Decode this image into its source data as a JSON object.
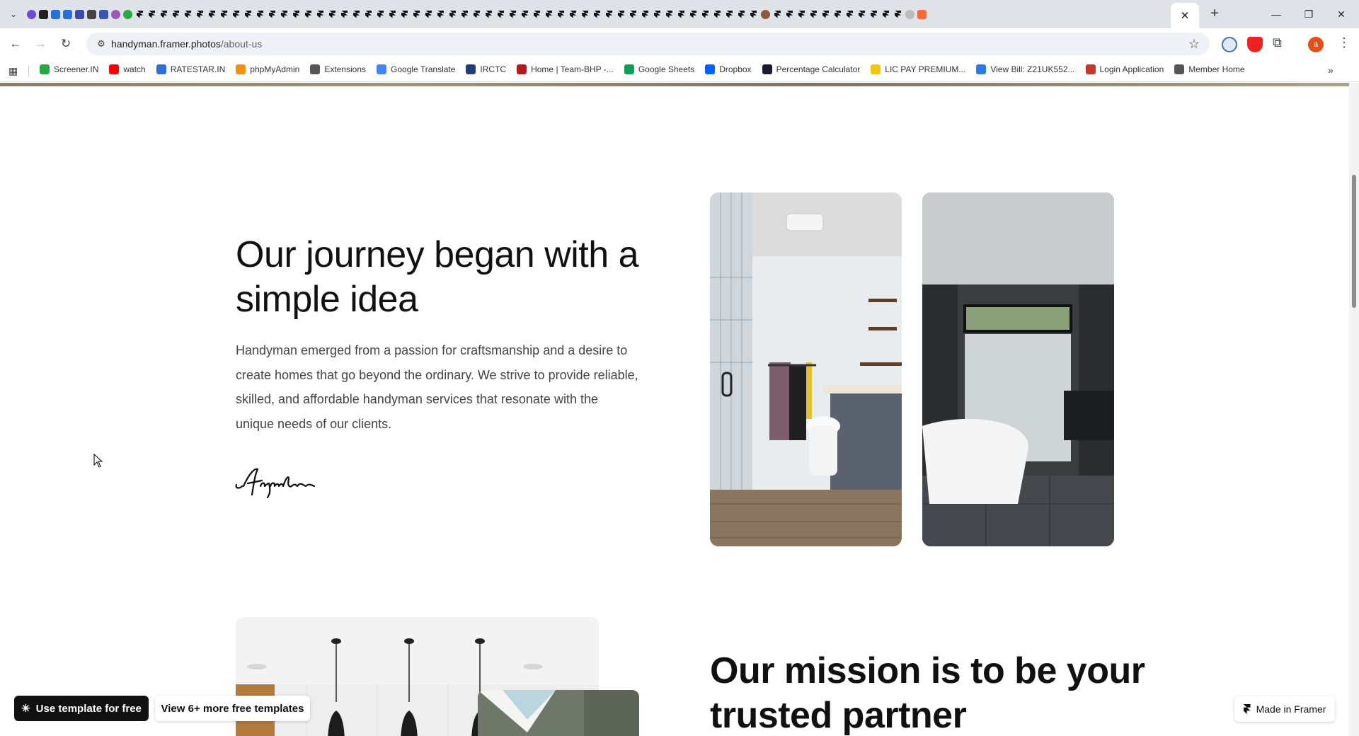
{
  "browser": {
    "url_host": "handyman.framer.photos",
    "url_path": "/about-us",
    "window_controls": {
      "minimize": "—",
      "restore": "❐",
      "close": "✕"
    },
    "new_tab_label": "+",
    "profile_initial": "a",
    "active_tab_close": "✕"
  },
  "bookmarks": [
    {
      "label": "Screener.IN",
      "color": "#27a844"
    },
    {
      "label": "watch",
      "color": "#ff0000"
    },
    {
      "label": "RATESTAR.IN",
      "color": "#2e6fd8"
    },
    {
      "label": "phpMyAdmin",
      "color": "#f29111"
    },
    {
      "label": "Extensions",
      "color": "#555555"
    },
    {
      "label": "Google Translate",
      "color": "#4285f4"
    },
    {
      "label": "IRCTC",
      "color": "#213d77"
    },
    {
      "label": "Home | Team-BHP -...",
      "color": "#b31b1b"
    },
    {
      "label": "Google Sheets",
      "color": "#0f9d58"
    },
    {
      "label": "Dropbox",
      "color": "#0061fe"
    },
    {
      "label": "Percentage Calculator",
      "color": "#1a1a2e"
    },
    {
      "label": "LIC PAY PREMIUM...",
      "color": "#f3c40d"
    },
    {
      "label": "View Bill: Z21UK552...",
      "color": "#2c7be5"
    },
    {
      "label": "Login Application",
      "color": "#c0392b"
    },
    {
      "label": "Member Home",
      "color": "#555555"
    }
  ],
  "content": {
    "heading": "Our journey began with a simple idea",
    "paragraph": "Handyman emerged from a passion for craftsmanship and a desire to create homes that go beyond the ordinary. We strive to provide reliable, skilled, and affordable handyman services that resonate with the unique needs of our clients.",
    "signature": "Alexander",
    "mission_heading": "Our mission is to be your trusted partner"
  },
  "overlay": {
    "use_template": "Use template for free",
    "more_templates": "View 6+ more free templates",
    "made_in_framer": "Made in Framer"
  }
}
